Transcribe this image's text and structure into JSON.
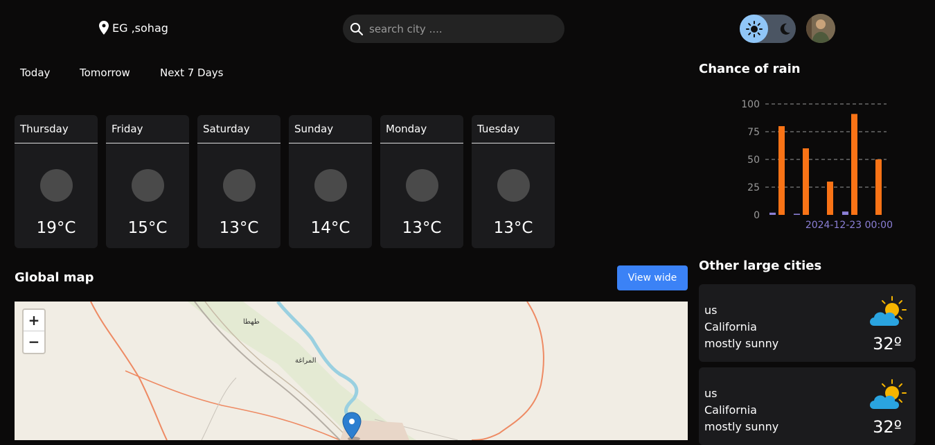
{
  "header": {
    "location": "EG ,sohag",
    "search_placeholder": "search city ...."
  },
  "tabs": [
    "Today",
    "Tomorrow",
    "Next 7 Days"
  ],
  "forecast": [
    {
      "day": "Thursday",
      "temp": "19°C"
    },
    {
      "day": "Friday",
      "temp": "15°C"
    },
    {
      "day": "Saturday",
      "temp": "13°C"
    },
    {
      "day": "Sunday",
      "temp": "14°C"
    },
    {
      "day": "Monday",
      "temp": "13°C"
    },
    {
      "day": "Tuesday",
      "temp": "13°C"
    }
  ],
  "map": {
    "title": "Global map",
    "view_wide_label": "View wide",
    "zoom_in": "+",
    "zoom_out": "−",
    "place_labels": [
      "طهطا",
      "المراغة"
    ]
  },
  "rain": {
    "title": "Chance of rain"
  },
  "chart_data": {
    "type": "bar",
    "title": "Chance of rain",
    "x_label_shown": "2024-12-23 00:00",
    "ylim": [
      0,
      100
    ],
    "yticks": [
      0,
      25,
      50,
      75,
      100
    ],
    "series": [
      {
        "color": "#8b7fd6",
        "values": [
          2,
          1,
          0,
          3,
          0
        ]
      },
      {
        "color": "#f97316",
        "values": [
          80,
          60,
          30,
          91,
          50
        ]
      }
    ],
    "grid": true
  },
  "cities": {
    "title": "Other large cities",
    "items": [
      {
        "country": "us",
        "name": "California",
        "condition": "mostly sunny",
        "temp": "32º"
      },
      {
        "country": "us",
        "name": "California",
        "condition": "mostly sunny",
        "temp": "32º"
      }
    ]
  },
  "colors": {
    "background": "#0b0a0a",
    "card": "#1b1b1d",
    "accent_blue": "#3b82f6",
    "rain_bar": "#f97316",
    "secondary_bar": "#8b7fd6"
  }
}
